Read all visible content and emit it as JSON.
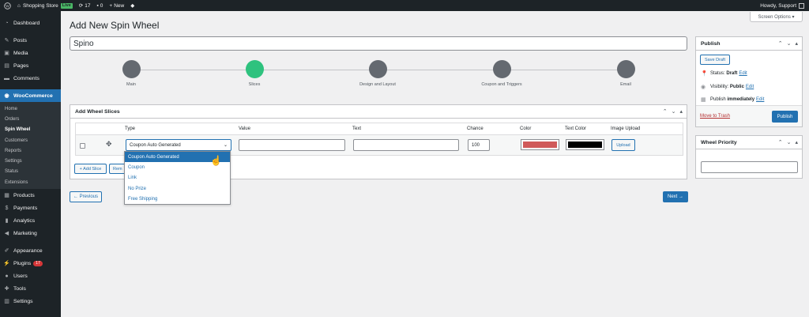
{
  "adminbar": {
    "site_name": "Shopping Store",
    "live_label": "Live",
    "updates_count": "17",
    "comments_count": "0",
    "new_label": "New",
    "howdy": "Howdy, Support"
  },
  "sidebar": {
    "items_top": [
      {
        "label": "Dashboard",
        "icon": "dashboard-icon"
      },
      {
        "label": "Posts",
        "icon": "pin-icon"
      },
      {
        "label": "Media",
        "icon": "media-icon"
      },
      {
        "label": "Pages",
        "icon": "pages-icon"
      },
      {
        "label": "Comments",
        "icon": "comments-icon"
      }
    ],
    "woocommerce": "WooCommerce",
    "submenu": [
      "Home",
      "Orders",
      "Spin Wheel",
      "Customers",
      "Reports",
      "Settings",
      "Status",
      "Extensions"
    ],
    "items_mid": [
      {
        "label": "Products",
        "icon": "products-icon"
      },
      {
        "label": "Payments",
        "icon": "payments-icon"
      },
      {
        "label": "Analytics",
        "icon": "analytics-icon"
      },
      {
        "label": "Marketing",
        "icon": "marketing-icon"
      }
    ],
    "items_bottom": [
      {
        "label": "Appearance",
        "icon": "appearance-icon"
      },
      {
        "label": "Plugins",
        "icon": "plugins-icon",
        "badge": "17"
      },
      {
        "label": "Users",
        "icon": "users-icon"
      },
      {
        "label": "Tools",
        "icon": "tools-icon"
      },
      {
        "label": "Settings",
        "icon": "settings-icon"
      }
    ]
  },
  "screen_options": "Screen Options ▾",
  "page_title": "Add New Spin Wheel",
  "title_value": "Spino",
  "steps": [
    "Main",
    "Slices",
    "Design and Layout",
    "Coupon and Triggers",
    "Email"
  ],
  "active_step": 1,
  "slices": {
    "header": "Add Wheel Slices",
    "columns": [
      "Type",
      "Value",
      "Text",
      "Chance",
      "Color",
      "Text Color",
      "Image Upload"
    ],
    "row": {
      "type": "Coupon Auto Generated",
      "value": "",
      "text": "",
      "chance": "100",
      "color": "#d05a5a",
      "text_color": "#000000",
      "upload_label": "Upload"
    },
    "add_label": "+ Add Slice",
    "remove_label": "Rem"
  },
  "dropdown_options": [
    "Coupon Auto Generated",
    "Coupon",
    "Link",
    "No Prize",
    "Free Shipping"
  ],
  "prev_label": "← Previous",
  "next_label": "Next →",
  "publish": {
    "header": "Publish",
    "save_draft": "Save Draft",
    "status_label": "Status:",
    "status_value": "Draft",
    "visibility_label": "Visibility:",
    "visibility_value": "Public",
    "publish_label": "Publish",
    "publish_value": "immediately",
    "edit": "Edit",
    "trash": "Move to Trash",
    "publish_btn": "Publish"
  },
  "priority": {
    "header": "Wheel Priority"
  }
}
